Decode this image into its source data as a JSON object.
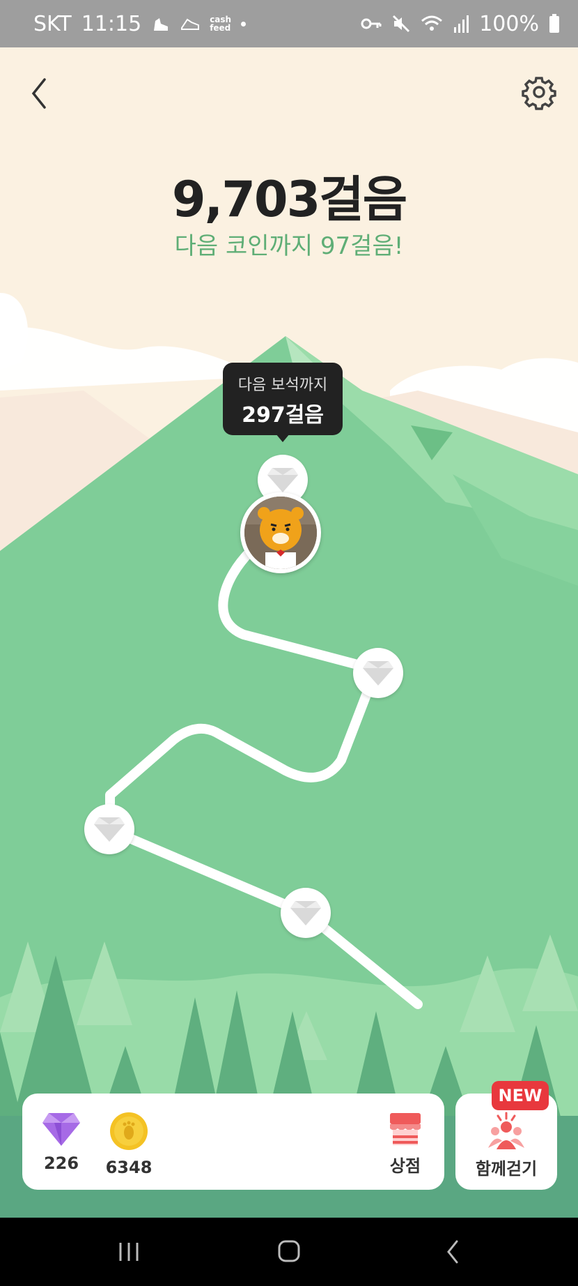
{
  "status_bar": {
    "carrier": "SKT",
    "time": "11:15",
    "cash_feed_text": "cash\nfeed",
    "battery": "100%"
  },
  "header": {
    "steps_count": "9,703걸음",
    "next_coin_text": "다음 코인까지 97걸음!"
  },
  "tooltip": {
    "line1": "다음 보석까지",
    "line2": "297걸음"
  },
  "bottom_bar": {
    "gems": "226",
    "coins": "6348",
    "shop_label": "상점",
    "walk_together_label": "함께걷기",
    "new_badge": "NEW"
  },
  "colors": {
    "sky": "#fbf1e1",
    "mountain": "#7fcd98",
    "path": "#ffffff",
    "accent_green": "#5fae76",
    "gem_purple": "#a66ae6",
    "coin_yellow": "#f4c224",
    "shop_red": "#ef5a5a",
    "badge_red": "#e8383d"
  },
  "icons": {
    "back": "chevron-left-icon",
    "settings": "gear-icon",
    "gem": "diamond-icon",
    "coin": "coin-icon",
    "shop": "store-icon",
    "together": "people-icon"
  }
}
